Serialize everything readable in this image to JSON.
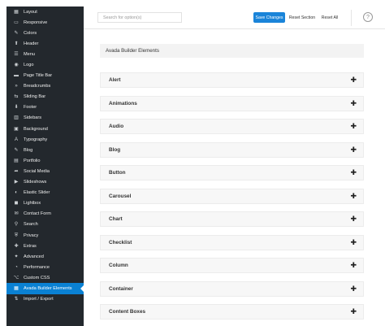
{
  "sidebar": {
    "items": [
      {
        "label": "Layout",
        "icon": "layout-icon",
        "glyph": "▦"
      },
      {
        "label": "Responsive",
        "icon": "responsive-icon",
        "glyph": "▭"
      },
      {
        "label": "Colors",
        "icon": "brush-icon",
        "glyph": "✎"
      },
      {
        "label": "Header",
        "icon": "pin-icon",
        "glyph": "⬆"
      },
      {
        "label": "Menu",
        "icon": "menu-icon",
        "glyph": "☰"
      },
      {
        "label": "Logo",
        "icon": "logo-icon",
        "glyph": "◉"
      },
      {
        "label": "Page Title Bar",
        "icon": "title-bar-icon",
        "glyph": "▬"
      },
      {
        "label": "Breadcrumbs",
        "icon": "breadcrumbs-icon",
        "glyph": "»"
      },
      {
        "label": "Sliding Bar",
        "icon": "sliding-bar-icon",
        "glyph": "⇆"
      },
      {
        "label": "Footer",
        "icon": "footer-icon",
        "glyph": "⬇"
      },
      {
        "label": "Sidebars",
        "icon": "sidebars-icon",
        "glyph": "▥"
      },
      {
        "label": "Background",
        "icon": "image-icon",
        "glyph": "▣"
      },
      {
        "label": "Typography",
        "icon": "typography-icon",
        "glyph": "A"
      },
      {
        "label": "Blog",
        "icon": "blog-icon",
        "glyph": "✎"
      },
      {
        "label": "Portfolio",
        "icon": "portfolio-icon",
        "glyph": "▤"
      },
      {
        "label": "Social Media",
        "icon": "share-icon",
        "glyph": "➦"
      },
      {
        "label": "Slideshows",
        "icon": "slideshow-icon",
        "glyph": "▶"
      },
      {
        "label": "Elastic Slider",
        "icon": "elastic-slider-icon",
        "glyph": "◐"
      },
      {
        "label": "Lightbox",
        "icon": "lightbox-icon",
        "glyph": "◼"
      },
      {
        "label": "Contact Form",
        "icon": "contact-icon",
        "glyph": "✉"
      },
      {
        "label": "Search",
        "icon": "search-icon",
        "glyph": "⚲"
      },
      {
        "label": "Privacy",
        "icon": "privacy-icon",
        "glyph": "⛨"
      },
      {
        "label": "Extras",
        "icon": "extras-icon",
        "glyph": "✚"
      },
      {
        "label": "Advanced",
        "icon": "advanced-icon",
        "glyph": "✦"
      },
      {
        "label": "Performance",
        "icon": "performance-icon",
        "glyph": "◔"
      },
      {
        "label": "Custom CSS",
        "icon": "code-icon",
        "glyph": "⌥"
      },
      {
        "label": "Avada Builder Elements",
        "icon": "builder-icon",
        "glyph": "▦",
        "active": true
      },
      {
        "label": "Import / Export",
        "icon": "import-export-icon",
        "glyph": "⇅"
      }
    ]
  },
  "topbar": {
    "search_placeholder": "Search for option(s)",
    "save_label": "Save Changes",
    "reset_section_label": "Reset Section",
    "reset_all_label": "Reset All",
    "help_glyph": "?"
  },
  "content": {
    "section_title": "Avada Builder Elements",
    "accordions": [
      "Alert",
      "Animations",
      "Audio",
      "Blog",
      "Button",
      "Carousel",
      "Chart",
      "Checklist",
      "Column",
      "Container",
      "Content Boxes"
    ],
    "plus_glyph": "✚"
  },
  "colors": {
    "sidebar_bg": "#23282d",
    "active_bg": "#0a81d3",
    "save_button": "#1a84d9"
  }
}
